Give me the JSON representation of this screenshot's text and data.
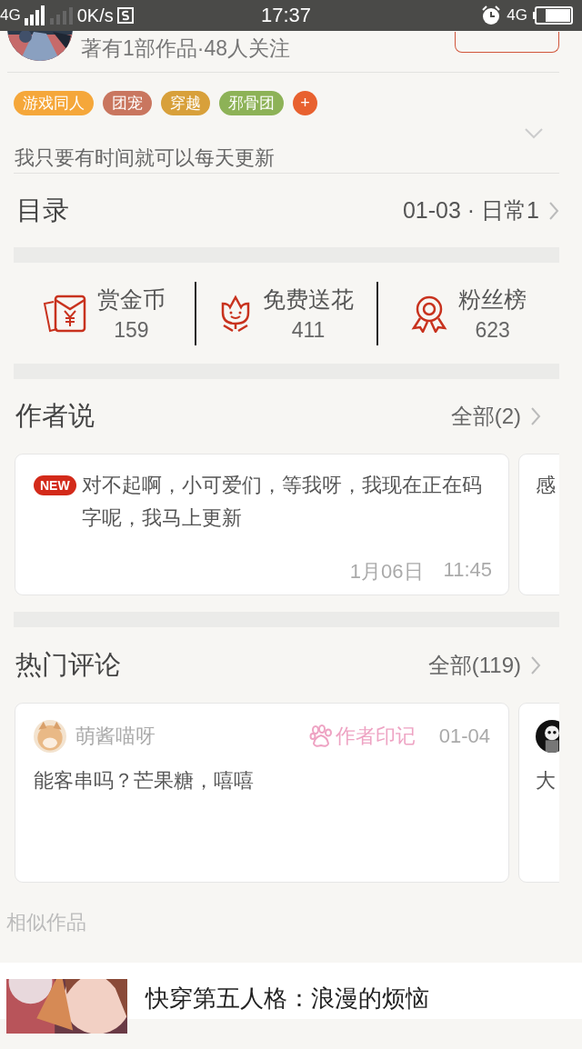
{
  "status_bar": {
    "network_left": "4G",
    "speed": "0K/s",
    "time": "17:37",
    "network_right": "4G"
  },
  "author": {
    "stats": "著有1部作品·48人关注"
  },
  "tags": [
    {
      "label": "游戏同人",
      "color": "#f5a73a",
      "kind": "tag"
    },
    {
      "label": "团宠",
      "color": "#c9765f",
      "kind": "tag"
    },
    {
      "label": "穿越",
      "color": "#d8a03a",
      "kind": "tag"
    },
    {
      "label": "邪骨团",
      "color": "#8db257",
      "kind": "tag"
    },
    {
      "label": "+",
      "color": "#e8612f",
      "kind": "add"
    }
  ],
  "intro": "我只要有时间就可以每天更新",
  "catalog": {
    "title": "目录",
    "latest": "01-03 · 日常1"
  },
  "stats": [
    {
      "kind": "coin",
      "label": "赏金币",
      "value": "159"
    },
    {
      "kind": "flower",
      "label": "免费送花",
      "value": "411"
    },
    {
      "kind": "fans",
      "label": "粉丝榜",
      "value": "623"
    }
  ],
  "author_notes": {
    "title": "作者说",
    "more": "全部(2)",
    "cards": [
      {
        "badge": "NEW",
        "text": "对不起啊，小可爱们，等我呀，我现在正在码字呢，我马上更新",
        "date": "1月06日",
        "time": "11:45"
      },
      {
        "text": "感"
      }
    ]
  },
  "hot_comments": {
    "title": "热门评论",
    "more": "全部(119)",
    "cards": [
      {
        "user": "萌酱喵呀",
        "mark": "作者印记",
        "date": "01-04",
        "text": "能客串吗？芒果糖，嘻嘻"
      },
      {
        "text": "大"
      }
    ]
  },
  "similar": {
    "title": "相似作品",
    "items": [
      {
        "title": "快穿第五人格：浪漫的烦恼"
      }
    ]
  }
}
